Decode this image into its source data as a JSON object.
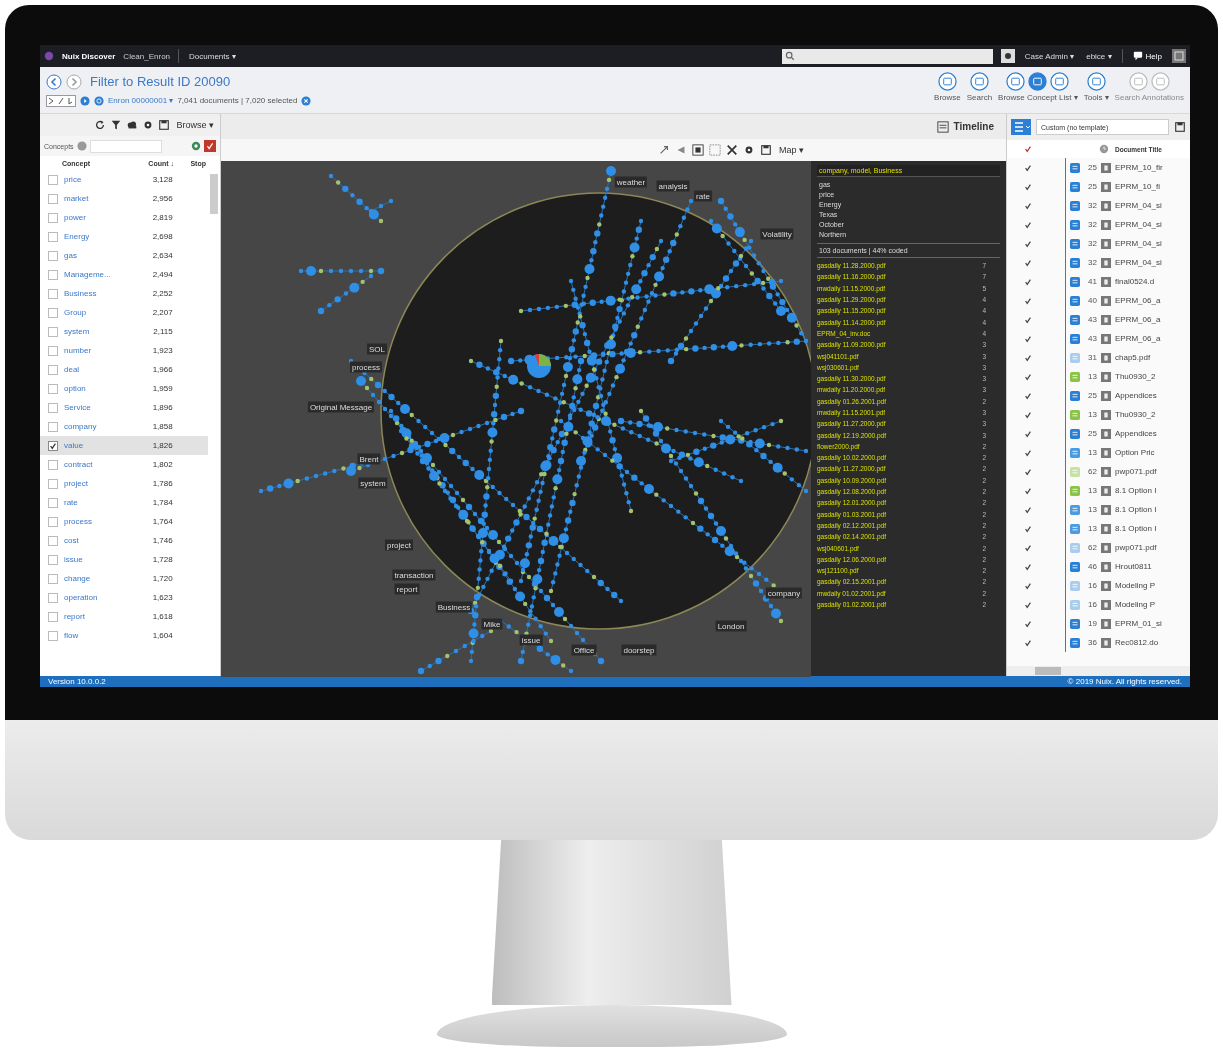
{
  "top_bar": {
    "app_name": "Nuix Discover",
    "case_name": "Clean_Enron",
    "menu": "Documents ▾",
    "user_menus": [
      "Case Admin ▾",
      "ebice ▾"
    ],
    "help": "Help"
  },
  "header": {
    "title": "Filter to Result ID 20090",
    "source": "Enron 00000001 ▾",
    "summary": "7,041 documents | 7,020 selected",
    "tools": [
      {
        "label": "Browse",
        "disabled": false,
        "icons": [
          {
            "selected": false
          }
        ]
      },
      {
        "label": "Search",
        "disabled": false,
        "icons": [
          {
            "selected": false
          }
        ]
      },
      {
        "label": "Browse Concept List ▾",
        "disabled": false,
        "icons": [
          {
            "selected": false
          },
          {
            "selected": true
          },
          {
            "selected": false
          }
        ]
      },
      {
        "label": "Tools ▾",
        "disabled": false,
        "icons": [
          {
            "selected": false
          }
        ]
      },
      {
        "label": "Search Annotations",
        "disabled": true,
        "icons": [
          {
            "selected": false
          },
          {
            "selected": false
          }
        ]
      }
    ]
  },
  "concepts": {
    "menu": "Browse ▾",
    "search_label": "Concepts",
    "columns": [
      "Concept",
      "Count ↓",
      "Stop"
    ],
    "rows": [
      {
        "concept": "price",
        "count": "3,128",
        "checked": false,
        "selected": false
      },
      {
        "concept": "market",
        "count": "2,956",
        "checked": false,
        "selected": false
      },
      {
        "concept": "power",
        "count": "2,819",
        "checked": false,
        "selected": false
      },
      {
        "concept": "Energy",
        "count": "2,698",
        "checked": false,
        "selected": false
      },
      {
        "concept": "gas",
        "count": "2,634",
        "checked": false,
        "selected": false
      },
      {
        "concept": "Manageme...",
        "count": "2,494",
        "checked": false,
        "selected": false
      },
      {
        "concept": "Business",
        "count": "2,252",
        "checked": false,
        "selected": false
      },
      {
        "concept": "Group",
        "count": "2,207",
        "checked": false,
        "selected": false
      },
      {
        "concept": "system",
        "count": "2,115",
        "checked": false,
        "selected": false
      },
      {
        "concept": "number",
        "count": "1,923",
        "checked": false,
        "selected": false
      },
      {
        "concept": "deal",
        "count": "1,966",
        "checked": false,
        "selected": false
      },
      {
        "concept": "option",
        "count": "1,959",
        "checked": false,
        "selected": false
      },
      {
        "concept": "Service",
        "count": "1,896",
        "checked": false,
        "selected": false
      },
      {
        "concept": "company",
        "count": "1,858",
        "checked": false,
        "selected": false
      },
      {
        "concept": "value",
        "count": "1,826",
        "checked": true,
        "selected": true
      },
      {
        "concept": "contract",
        "count": "1,802",
        "checked": false,
        "selected": false
      },
      {
        "concept": "project",
        "count": "1,786",
        "checked": false,
        "selected": false
      },
      {
        "concept": "rate",
        "count": "1,784",
        "checked": false,
        "selected": false
      },
      {
        "concept": "process",
        "count": "1,764",
        "checked": false,
        "selected": false
      },
      {
        "concept": "cost",
        "count": "1,746",
        "checked": false,
        "selected": false
      },
      {
        "concept": "issue",
        "count": "1,728",
        "checked": false,
        "selected": false
      },
      {
        "concept": "change",
        "count": "1,720",
        "checked": false,
        "selected": false
      },
      {
        "concept": "operation",
        "count": "1,623",
        "checked": false,
        "selected": false
      },
      {
        "concept": "report",
        "count": "1,618",
        "checked": false,
        "selected": false
      },
      {
        "concept": "flow",
        "count": "1,604",
        "checked": false,
        "selected": false
      }
    ]
  },
  "map": {
    "timeline": "Timeline",
    "view_menu": "Map ▾",
    "labels": [
      "weather",
      "analysis",
      "rate",
      "Volatility",
      "SOL",
      "process",
      "Original Message",
      "Brent",
      "system",
      "project",
      "transaction",
      "report",
      "Business",
      "Mike",
      "issue",
      "Office",
      "doorstep",
      "London",
      "company"
    ],
    "doc_panel": {
      "title": "company, model, Business",
      "terms": [
        "gas",
        "price",
        "Energy",
        "Texas",
        "October",
        "Northern"
      ],
      "summary": "103 documents | 44% coded",
      "docs": [
        {
          "name": "gasdaily 11.28.2000.pdf",
          "count": "7"
        },
        {
          "name": "gasdaily 11.16.2000.pdf",
          "count": "7"
        },
        {
          "name": "mwdaily 11.15.2000.pdf",
          "count": "5"
        },
        {
          "name": "gasdaily 11.29.2000.pdf",
          "count": "4"
        },
        {
          "name": "gasdaily 11.15.2000.pdf",
          "count": "4"
        },
        {
          "name": "gasdaily 11.14.2000.pdf",
          "count": "4"
        },
        {
          "name": "EPRM_04_inv.doc",
          "count": "4"
        },
        {
          "name": "gasdaily 11.09.2000.pdf",
          "count": "3"
        },
        {
          "name": "wsj041101.pdf",
          "count": "3"
        },
        {
          "name": "wsj030601.pdf",
          "count": "3"
        },
        {
          "name": "gasdaily 11.30.2000.pdf",
          "count": "3"
        },
        {
          "name": "mwdaily 11.20.2000.pdf",
          "count": "3"
        },
        {
          "name": "gasdaily 01.26.2001.pdf",
          "count": "2"
        },
        {
          "name": "mwdaily 11.15.2001.pdf",
          "count": "3"
        },
        {
          "name": "gasdaily 11.27.2000.pdf",
          "count": "3"
        },
        {
          "name": "gasdaily 12.19.2000.pdf",
          "count": "3"
        },
        {
          "name": "flower2000.pdf",
          "count": "2"
        },
        {
          "name": "gasdaily 10.02.2000.pdf",
          "count": "2"
        },
        {
          "name": "gasdaily 11.27.2000.pdf",
          "count": "2"
        },
        {
          "name": "gasdaily 10.09.2000.pdf",
          "count": "2"
        },
        {
          "name": "gasdaily 12.08.2000.pdf",
          "count": "2"
        },
        {
          "name": "gasdaily 12.01.2000.pdf",
          "count": "2"
        },
        {
          "name": "gasdaily 01.03.2001.pdf",
          "count": "2"
        },
        {
          "name": "gasdaily 02.12.2001.pdf",
          "count": "2"
        },
        {
          "name": "gasdaily 02.14.2001.pdf",
          "count": "2"
        },
        {
          "name": "wsj040601.pdf",
          "count": "2"
        },
        {
          "name": "gasdaily 12.06.2000.pdf",
          "count": "2"
        },
        {
          "name": "wsj121100.pdf",
          "count": "2"
        },
        {
          "name": "gasdaily 02.15.2001.pdf",
          "count": "2"
        },
        {
          "name": "mwdaily 01.02.2001.pdf",
          "count": "2"
        },
        {
          "name": "gasdaily 01.02.2001.pdf",
          "count": "2"
        }
      ]
    }
  },
  "documents": {
    "template": "Custom (no template)",
    "column_title": "Document Title",
    "header_checked": true,
    "rows": [
      {
        "checked": true,
        "color": "#2b7fd4",
        "number": "25",
        "title": "EPRM_10_fir"
      },
      {
        "checked": true,
        "color": "#2b7fd4",
        "number": "25",
        "title": "EPRM_10_fi"
      },
      {
        "checked": true,
        "color": "#2b7fd4",
        "number": "32",
        "title": "EPRM_04_si"
      },
      {
        "checked": true,
        "color": "#2b7fd4",
        "number": "32",
        "title": "EPRM_04_si"
      },
      {
        "checked": true,
        "color": "#2b7fd4",
        "number": "32",
        "title": "EPRM_04_si"
      },
      {
        "checked": true,
        "color": "#2b7fd4",
        "number": "32",
        "title": "EPRM_04_si"
      },
      {
        "checked": true,
        "color": "#2b7fd4",
        "number": "41",
        "title": "final0524.d"
      },
      {
        "checked": true,
        "color": "#2b7fd4",
        "number": "40",
        "title": "EPRM_06_a"
      },
      {
        "checked": true,
        "color": "#2b7fd4",
        "number": "43",
        "title": "EPRM_06_a"
      },
      {
        "checked": true,
        "color": "#2b7fd4",
        "number": "43",
        "title": "EPRM_06_a"
      },
      {
        "checked": true,
        "color": "#a9cdee",
        "number": "31",
        "title": "chap5.pdf"
      },
      {
        "checked": true,
        "color": "#8bc34a",
        "number": "13",
        "title": "Thu0930_2"
      },
      {
        "checked": true,
        "color": "#2b7fd4",
        "number": "25",
        "title": "Appendices"
      },
      {
        "checked": true,
        "color": "#8bc34a",
        "number": "13",
        "title": "Thu0930_2"
      },
      {
        "checked": true,
        "color": "#2b7fd4",
        "number": "25",
        "title": "Appendices"
      },
      {
        "checked": true,
        "color": "#4a9be0",
        "number": "13",
        "title": "Option Pric"
      },
      {
        "checked": true,
        "color": "#c5e1a5",
        "number": "62",
        "title": "pwp071.pdf"
      },
      {
        "checked": true,
        "color": "#8bc34a",
        "number": "13",
        "title": "8.1 Option I"
      },
      {
        "checked": true,
        "color": "#4a9be0",
        "number": "13",
        "title": "8.1 Option I"
      },
      {
        "checked": true,
        "color": "#4a9be0",
        "number": "13",
        "title": "8.1 Option I"
      },
      {
        "checked": true,
        "color": "#a9cdee",
        "number": "62",
        "title": "pwp071.pdf"
      },
      {
        "checked": true,
        "color": "#2b7fd4",
        "number": "46",
        "title": "Hrout0811"
      },
      {
        "checked": true,
        "color": "#a9cdee",
        "number": "16",
        "title": "Modeling P"
      },
      {
        "checked": true,
        "color": "#a9cdee",
        "number": "16",
        "title": "Modeling P"
      },
      {
        "checked": true,
        "color": "#2b7fd4",
        "number": "19",
        "title": "EPRM_01_si"
      },
      {
        "checked": true,
        "color": "#2b7fd4",
        "number": "36",
        "title": "Rec0812.do"
      }
    ]
  },
  "status_bar": {
    "version": "Version 10.0.0.2",
    "copyright": "© 2019 Nuix. All rights reserved."
  }
}
